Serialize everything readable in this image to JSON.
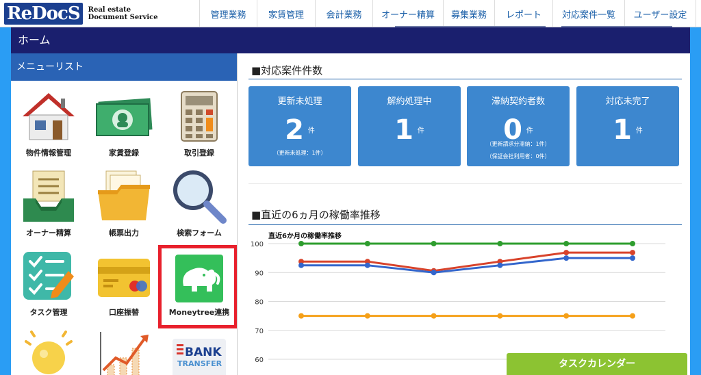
{
  "logo": {
    "prefix": "Re",
    "name": "DocS",
    "tagline_line1": "Real estate",
    "tagline_line2": "Document Service"
  },
  "nav": [
    {
      "label": "管理業務"
    },
    {
      "label": "家賃管理"
    },
    {
      "label": "会計業務"
    },
    {
      "label": "オーナー精算"
    },
    {
      "label": "募集業務"
    },
    {
      "label": "レポート"
    },
    {
      "label": "対応案件一覧"
    },
    {
      "label": "ユーザー設定"
    }
  ],
  "page_title": "ホーム",
  "menu": {
    "header": "メニューリスト",
    "items": [
      {
        "label": "物件情報管理",
        "icon": "house-icon"
      },
      {
        "label": "家賃登録",
        "icon": "banknote-icon"
      },
      {
        "label": "取引登録",
        "icon": "calculator-icon"
      },
      {
        "label": "オーナー精算",
        "icon": "inbox-tray-icon"
      },
      {
        "label": "帳票出力",
        "icon": "folder-icon"
      },
      {
        "label": "検索フォーム",
        "icon": "magnifier-icon"
      },
      {
        "label": "タスク管理",
        "icon": "checklist-icon"
      },
      {
        "label": "口座振替",
        "icon": "credit-card-icon"
      },
      {
        "label": "Moneytree連携",
        "icon": "moneytree-elephant-icon"
      },
      {
        "label": "",
        "icon": "lightbulb-icon"
      },
      {
        "label": "",
        "icon": "growth-chart-icon"
      },
      {
        "label": "",
        "icon": "bank-transfer-icon",
        "icon_text_1": "BANK",
        "icon_text_2": "TRANSFER"
      }
    ]
  },
  "cases": {
    "title": "■対応案件件数",
    "cards": [
      {
        "title": "更新未処理",
        "count": "2",
        "unit": "件",
        "sub": [
          "（更新未処理：1件）"
        ]
      },
      {
        "title": "解約処理中",
        "count": "1",
        "unit": "件",
        "sub": []
      },
      {
        "title": "滞納契約者数",
        "count": "0",
        "unit": "件",
        "sub": [
          "（更新請求分滞納：1件）",
          "（保証会社利用者：0件）"
        ]
      },
      {
        "title": "対応未完了",
        "count": "1",
        "unit": "件",
        "sub": []
      }
    ]
  },
  "utilization": {
    "title": "■直近の6ヵ月の稼働率推移",
    "chart_title": "直近6か月の稼働率推移"
  },
  "chart_data": {
    "type": "line",
    "title": "直近6か月の稼働率推移",
    "x": [
      1,
      2,
      3,
      4,
      5,
      6
    ],
    "ylim": [
      60,
      100
    ],
    "yticks": [
      60,
      70,
      80,
      90,
      100
    ],
    "grid": true,
    "series": [
      {
        "values": [
          100,
          100,
          100,
          100,
          100,
          100
        ],
        "color": "#2e9d2e"
      },
      {
        "values": [
          93.8,
          93.8,
          90.6,
          93.8,
          96.9,
          96.9
        ],
        "color": "#d8432b"
      },
      {
        "values": [
          92.5,
          92.5,
          90.0,
          92.5,
          95.0,
          95.0
        ],
        "color": "#3366cc"
      },
      {
        "values": [
          75,
          75,
          75,
          75,
          75,
          75
        ],
        "color": "#f5a019"
      }
    ]
  },
  "task_calendar": {
    "label": "タスクカレンダー"
  },
  "colors": {
    "brand": "#1b3f8f",
    "titlebar": "#1a1f6e",
    "accent_blue": "#2a9df4",
    "card_blue": "#3d87cf",
    "highlight_red": "#e8202c",
    "calendar_green": "#8cc332"
  }
}
